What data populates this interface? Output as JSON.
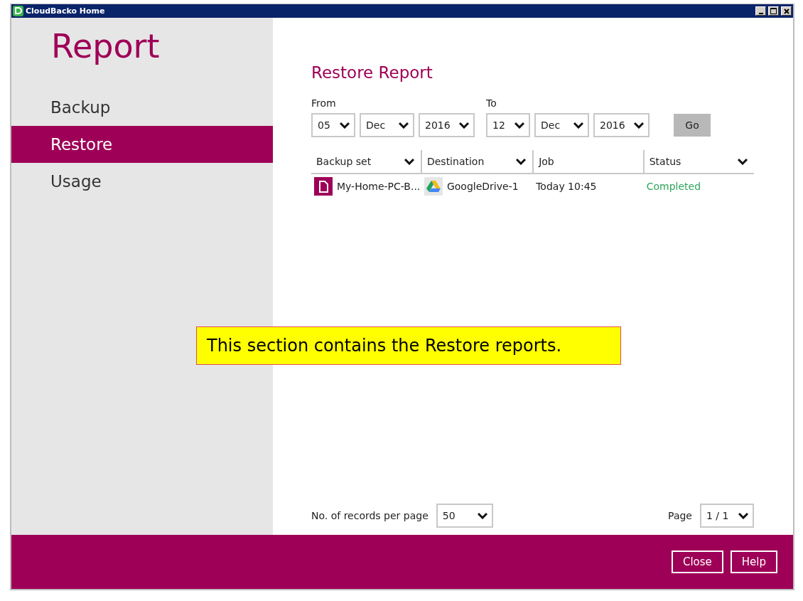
{
  "window": {
    "title": "CloudBacko Home"
  },
  "sidebar": {
    "title": "Report",
    "items": [
      {
        "label": "Backup",
        "selected": false
      },
      {
        "label": "Restore",
        "selected": true
      },
      {
        "label": "Usage",
        "selected": false
      }
    ]
  },
  "main": {
    "title": "Restore Report",
    "from": {
      "label": "From",
      "day": "05",
      "month": "Dec",
      "year": "2016"
    },
    "to": {
      "label": "To",
      "day": "12",
      "month": "Dec",
      "year": "2016"
    },
    "go_button": "Go",
    "table": {
      "columns": [
        {
          "label": "Backup set",
          "sortable": true
        },
        {
          "label": "Destination",
          "sortable": true
        },
        {
          "label": "Job",
          "sortable": false
        },
        {
          "label": "Status",
          "sortable": true
        }
      ],
      "rows": [
        {
          "backup_set": "My-Home-PC-B...",
          "destination": "GoogleDrive-1",
          "job": "Today 10:45",
          "status": "Completed",
          "color": "#2ea55a"
        }
      ]
    },
    "records_label": "No. of records per page",
    "records_per_page": "50",
    "page_label": "Page",
    "page": "1 / 1"
  },
  "callout": "This section contains the Restore reports.",
  "footer": {
    "buttons": [
      "Close",
      "Help"
    ]
  }
}
